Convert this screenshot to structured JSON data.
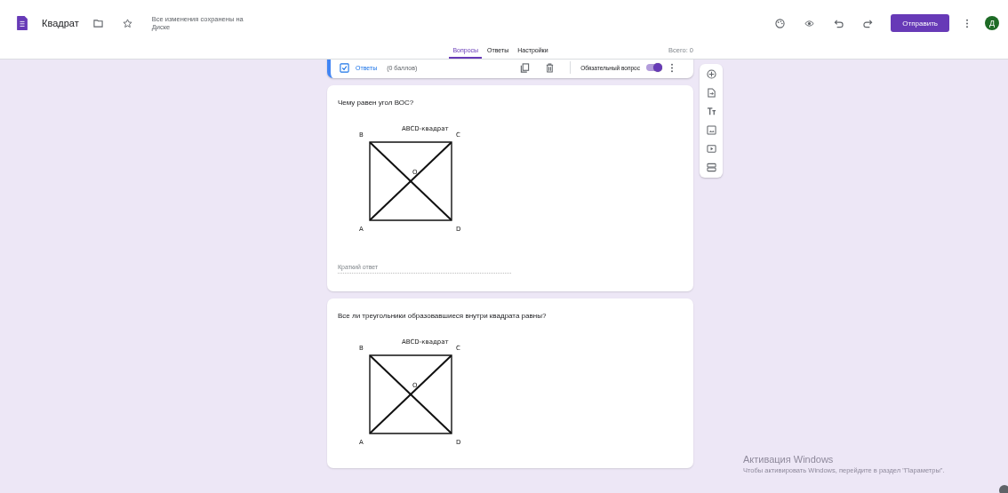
{
  "header": {
    "title": "Квадрат",
    "save_status": "Все изменения сохранены на Диске",
    "send_button": "Отправить",
    "avatar": "Д"
  },
  "tabs": [
    {
      "label": "Вопросы",
      "selected": true
    },
    {
      "label": "Ответы",
      "selected": false
    },
    {
      "label": "Настройки",
      "selected": false
    }
  ],
  "total": "Всего: 0",
  "question_footer": {
    "answers_link": "Ответы",
    "points": "(0 баллов)",
    "required_label": "Обязательный вопрос",
    "required": true
  },
  "questions": [
    {
      "text": "Чему равен угол ВОС?",
      "diagram": {
        "title": "ABCD-квадрат",
        "labels": [
          "B",
          "C",
          "O",
          "A",
          "D"
        ]
      },
      "placeholder": "Краткий ответ"
    },
    {
      "text": "Все ли треугольники образовавшиеся внутри квадрата равны?",
      "diagram": {
        "title": "ABCD-квадрат",
        "labels": [
          "B",
          "C",
          "O",
          "A",
          "D"
        ]
      }
    }
  ],
  "os_notice": {
    "title": "Активация Windows",
    "text": "Чтобы активировать Windows, перейдите в раздел \"Параметры\"."
  }
}
